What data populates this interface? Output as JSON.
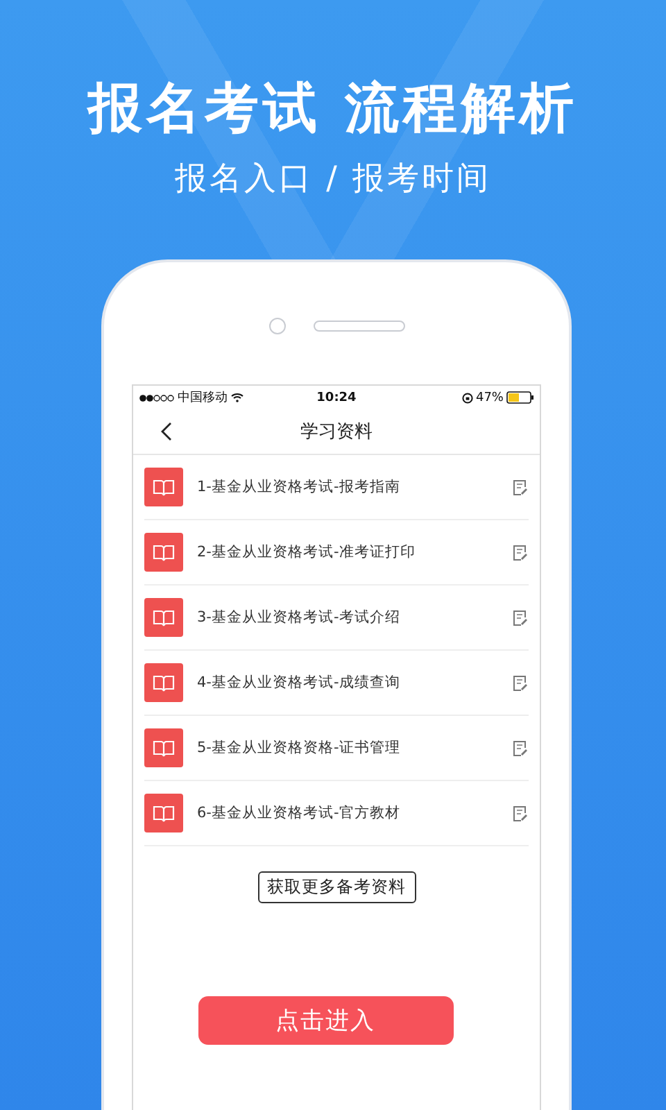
{
  "headline": "报名考试 流程解析",
  "subheadline": "报名入口 / 报考时间",
  "status_bar": {
    "carrier": "中国移动",
    "time": "10:24",
    "battery": "47%"
  },
  "nav": {
    "title": "学习资料"
  },
  "materials": [
    {
      "title": "1-基金从业资格考试-报考指南"
    },
    {
      "title": "2-基金从业资格考试-准考证打印"
    },
    {
      "title": "3-基金从业资格考试-考试介绍"
    },
    {
      "title": "4-基金从业资格考试-成绩查询"
    },
    {
      "title": "5-基金从业资格资格-证书管理"
    },
    {
      "title": "6-基金从业资格考试-官方教材"
    }
  ],
  "more_button": "获取更多备考资料",
  "enter_button": "点击进入"
}
